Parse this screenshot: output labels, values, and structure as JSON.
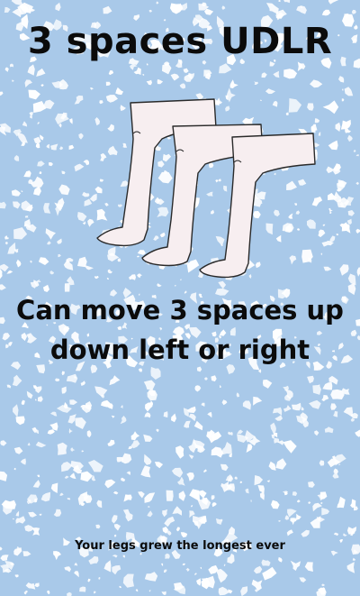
{
  "card": {
    "title": "3 spaces UDLR",
    "description": "Can move 3 spaces up down left or right",
    "flavor_text": "Your legs grew the longest ever",
    "illustration_icon": "three-legs-icon"
  },
  "colors": {
    "background": "#a9c9e9",
    "speckle": "#ffffff",
    "text": "#0b0b0b",
    "leg_fill": "#f7eef0",
    "leg_stroke": "#2a2a2a"
  }
}
